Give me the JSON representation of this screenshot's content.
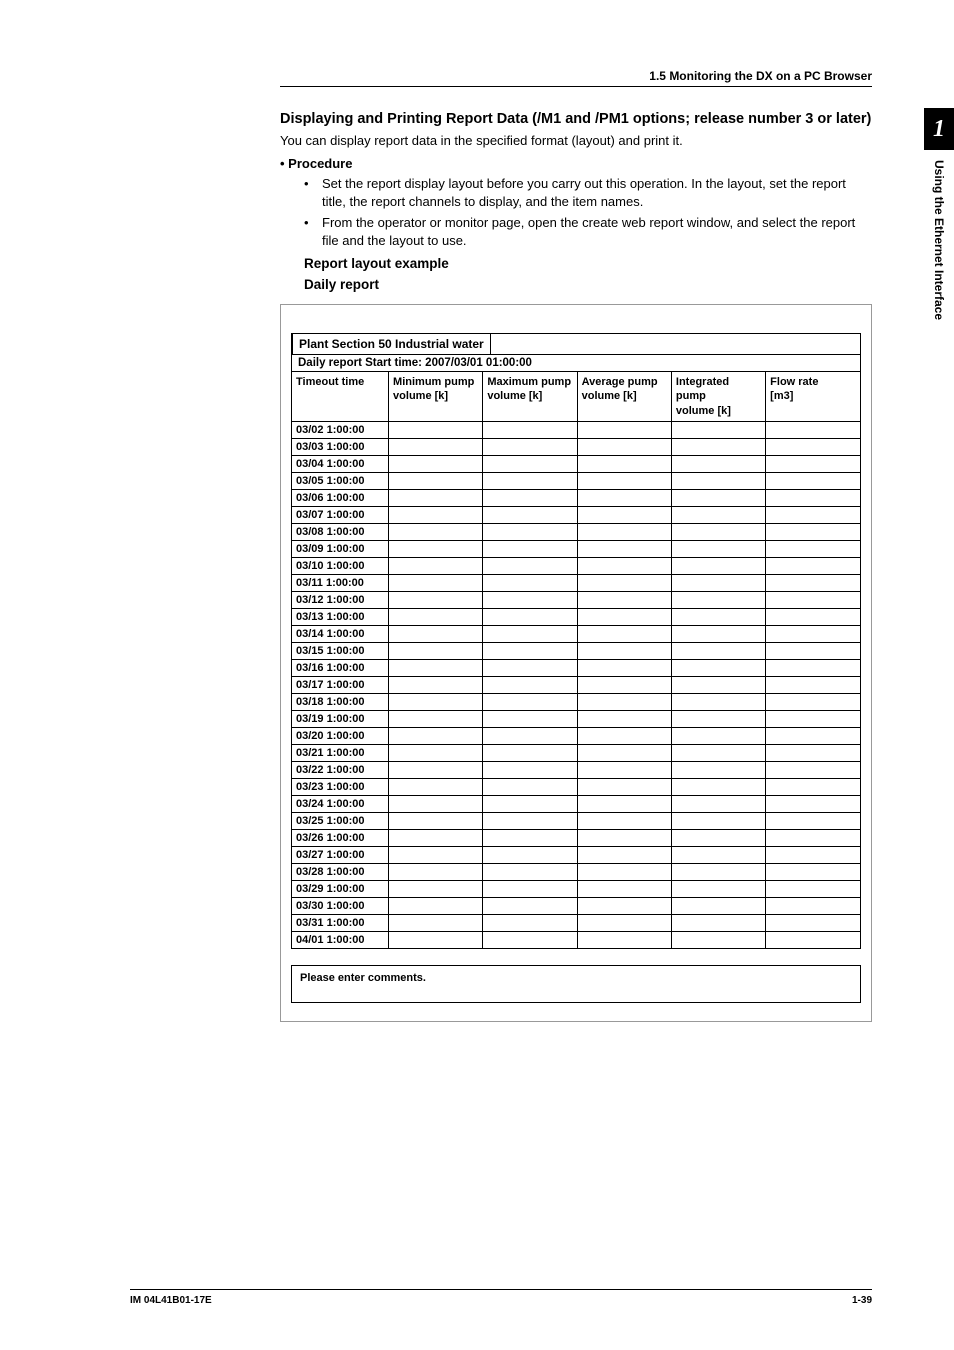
{
  "header": {
    "breadcrumb": "1.5  Monitoring the DX on a PC Browser"
  },
  "sidetab": {
    "number": "1",
    "text": "Using the Ethernet Interface"
  },
  "section": {
    "title": "Displaying and Printing Report Data (/M1 and /PM1 options; release number 3 or later)",
    "intro": "You can display report data in the specified format (layout) and print it.",
    "procedure_label": "•  Procedure",
    "bullets": [
      "Set the report display layout before you carry out this operation. In the layout, set the report title, the report channels to display, and the item names.",
      "From the operator or monitor page, open the create web report window, and select the report file and the layout to use."
    ],
    "layout_heading": "Report layout example",
    "report_heading": "Daily report"
  },
  "report": {
    "title": "Plant  Section 50  Industrial water",
    "subtitle": "Daily report  Start time: 2007/03/01 01:00:00",
    "columns": [
      "Timeout time",
      "Minimum pump volume [k]",
      "Maximum pump volume [k]",
      "Average pump volume [k]",
      "Integrated pump volume [k]",
      "Flow rate [m3]"
    ],
    "rows": [
      "03/02 1:00:00",
      "03/03 1:00:00",
      "03/04 1:00:00",
      "03/05 1:00:00",
      "03/06 1:00:00",
      "03/07 1:00:00",
      "03/08 1:00:00",
      "03/09 1:00:00",
      "03/10 1:00:00",
      "03/11 1:00:00",
      "03/12 1:00:00",
      "03/13 1:00:00",
      "03/14 1:00:00",
      "03/15 1:00:00",
      "03/16 1:00:00",
      "03/17 1:00:00",
      "03/18 1:00:00",
      "03/19 1:00:00",
      "03/20 1:00:00",
      "03/21 1:00:00",
      "03/22 1:00:00",
      "03/23 1:00:00",
      "03/24 1:00:00",
      "03/25 1:00:00",
      "03/26 1:00:00",
      "03/27 1:00:00",
      "03/28 1:00:00",
      "03/29 1:00:00",
      "03/30 1:00:00",
      "03/31 1:00:00",
      "04/01 1:00:00"
    ],
    "comments": "Please enter comments."
  },
  "footer": {
    "doc_id": "IM 04L41B01-17E",
    "page": "1-39"
  }
}
